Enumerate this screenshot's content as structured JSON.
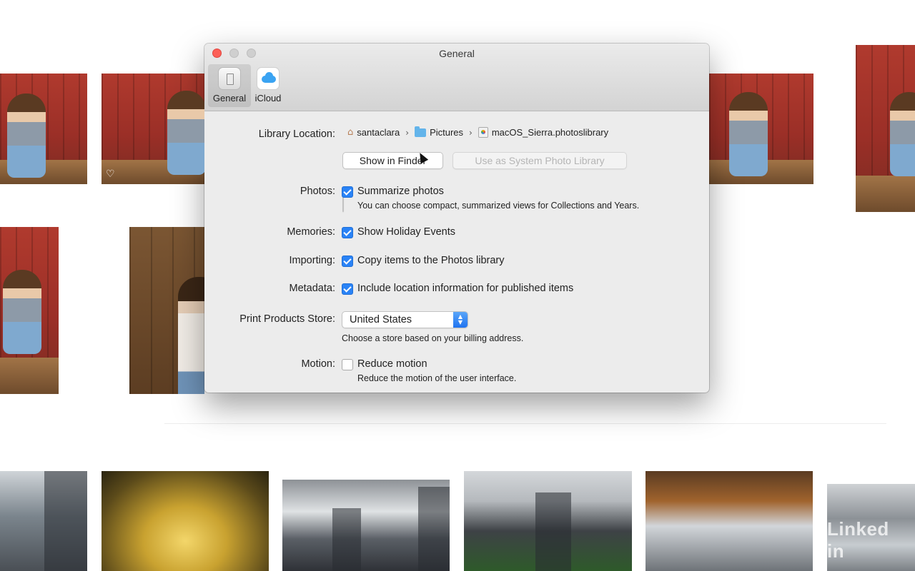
{
  "window": {
    "title": "General"
  },
  "toolbar": {
    "tabs": [
      {
        "label": "General",
        "icon": "general-settings-icon",
        "selected": true
      },
      {
        "label": "iCloud",
        "icon": "icloud-icon",
        "selected": false
      }
    ]
  },
  "library": {
    "label": "Library Location:",
    "path": [
      {
        "name": "santaclara",
        "icon": "home-icon"
      },
      {
        "name": "Pictures",
        "icon": "folder-icon"
      },
      {
        "name": "macOS_Sierra.photoslibrary",
        "icon": "photos-library-icon"
      }
    ],
    "show_in_finder": "Show in Finder",
    "use_as_system": "Use as System Photo Library",
    "use_as_system_enabled": false
  },
  "photos": {
    "label": "Photos:",
    "option": "Summarize photos",
    "checked": true,
    "hint": "You can choose compact, summarized views for Collections and Years."
  },
  "memories": {
    "label": "Memories:",
    "option": "Show Holiday Events",
    "checked": true
  },
  "importing": {
    "label": "Importing:",
    "option": "Copy items to the Photos library",
    "checked": true
  },
  "metadata": {
    "label": "Metadata:",
    "option": "Include location information for published items",
    "checked": true
  },
  "print_store": {
    "label": "Print Products Store:",
    "value": "United States",
    "hint": "Choose a store based on your billing address."
  },
  "motion": {
    "label": "Motion:",
    "option": "Reduce motion",
    "checked": false,
    "hint": "Reduce the motion of the user interface."
  },
  "watermark": "Linked in",
  "colors": {
    "accent": "#2a83f6",
    "close": "#fc5f57",
    "window_bg": "#ececec"
  }
}
